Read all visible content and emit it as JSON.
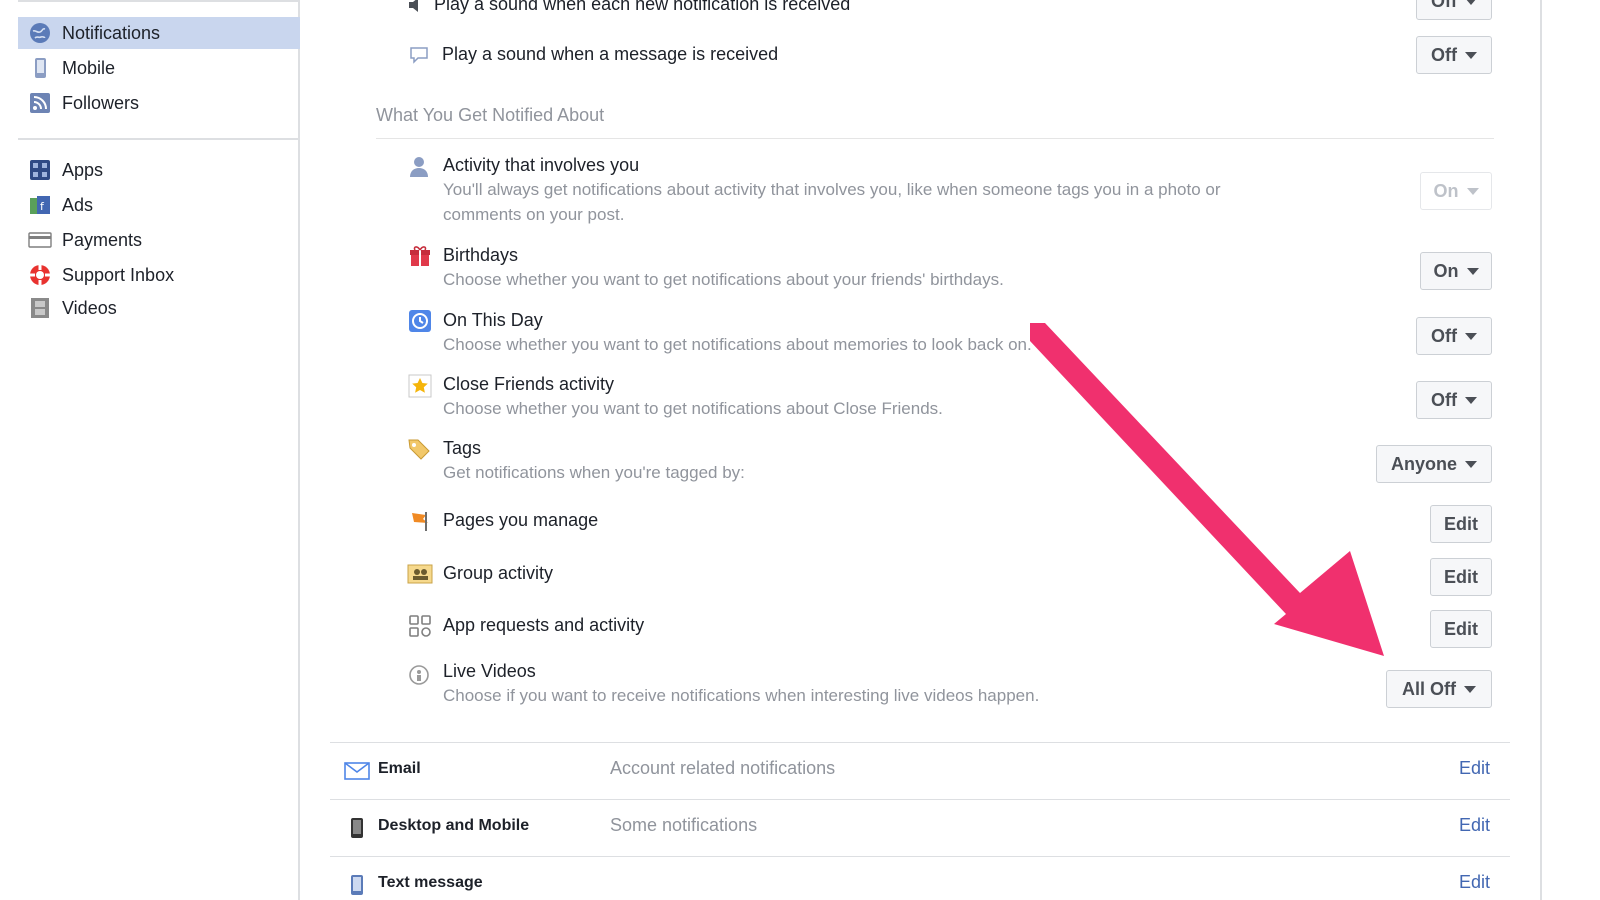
{
  "sidebar": {
    "items": [
      {
        "label": "Notifications",
        "icon": "globe-icon"
      },
      {
        "label": "Mobile",
        "icon": "mobile-icon"
      },
      {
        "label": "Followers",
        "icon": "rss-icon"
      },
      {
        "label": "Apps",
        "icon": "apps-icon"
      },
      {
        "label": "Ads",
        "icon": "ads-icon"
      },
      {
        "label": "Payments",
        "icon": "credit-card-icon"
      },
      {
        "label": "Support Inbox",
        "icon": "lifebuoy-icon"
      },
      {
        "label": "Videos",
        "icon": "film-icon"
      }
    ]
  },
  "sound_rows": [
    {
      "label": "Play a sound when each new notification is received",
      "value": "Off"
    },
    {
      "label": "Play a sound when a message is received",
      "value": "Off"
    }
  ],
  "section": {
    "title": "What You Get Notified About"
  },
  "notify_rows": [
    {
      "title": "Activity that involves you",
      "desc1": "You'll always get notifications about activity that involves you, like when someone tags you in a photo or",
      "desc2": "comments on your post.",
      "value": "On",
      "disabled": true
    },
    {
      "title": "Birthdays",
      "desc1": "Choose whether you want to get notifications about your friends' birthdays.",
      "value": "On"
    },
    {
      "title": "On This Day",
      "desc1": "Choose whether you want to get notifications about memories to look back on.",
      "value": "Off"
    },
    {
      "title": "Close Friends activity",
      "desc1": "Choose whether you want to get notifications about Close Friends.",
      "value": "Off"
    },
    {
      "title": "Tags",
      "desc1": "Get notifications when you're tagged by:",
      "value": "Anyone"
    },
    {
      "title": "Pages you manage",
      "value": "Edit"
    },
    {
      "title": "Group activity",
      "value": "Edit"
    },
    {
      "title": "App requests and activity",
      "value": "Edit"
    },
    {
      "title": "Live Videos",
      "desc1": "Choose if you want to receive notifications when interesting live videos happen.",
      "value": "All Off"
    }
  ],
  "channels": [
    {
      "label": "Email",
      "desc": "Account related notifications",
      "edit": "Edit"
    },
    {
      "label": "Desktop and Mobile",
      "desc": "Some notifications",
      "edit": "Edit"
    },
    {
      "label": "Text message",
      "desc": "",
      "edit": "Edit"
    }
  ],
  "colors": {
    "accent": "#4267b2",
    "arrow": "#f0306e",
    "active_bg": "#c9d6ee"
  }
}
